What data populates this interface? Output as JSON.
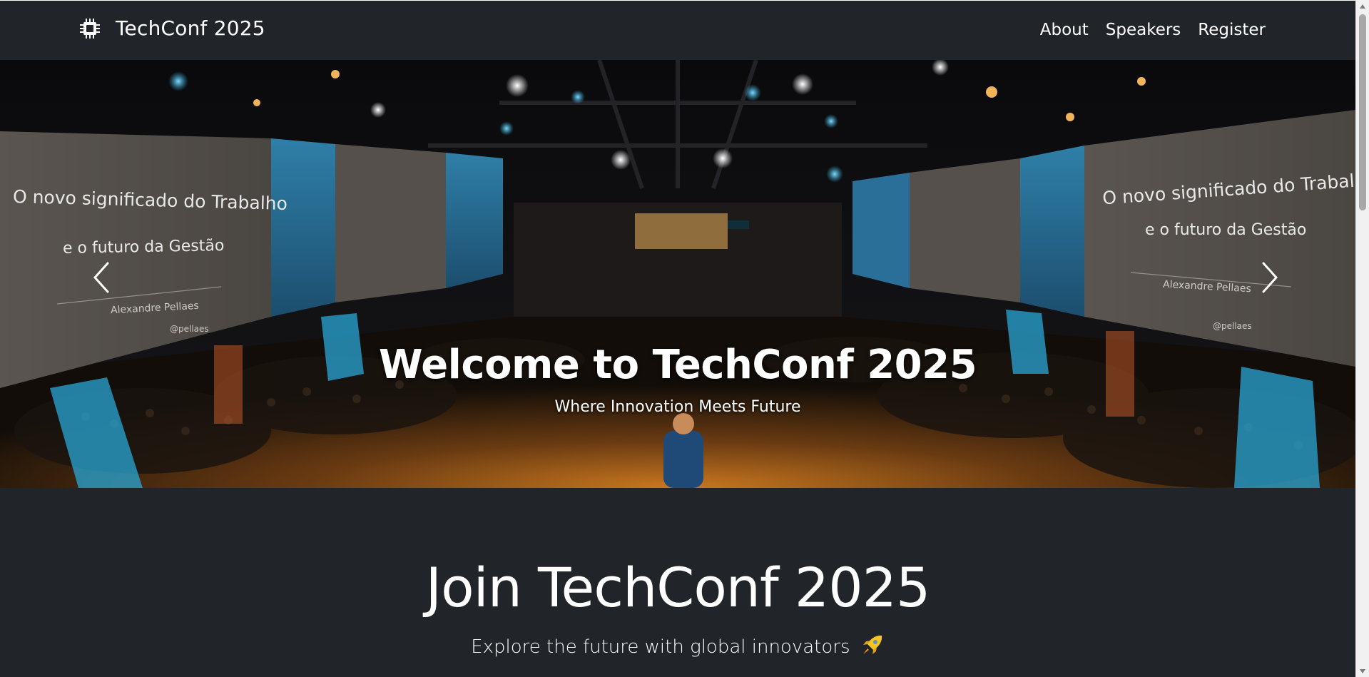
{
  "navbar": {
    "brand": "TechConf 2025",
    "brand_icon": "cpu-chip-icon",
    "links": [
      {
        "label": "About"
      },
      {
        "label": "Speakers"
      },
      {
        "label": "Register"
      }
    ]
  },
  "hero": {
    "title": "Welcome to TechConf 2025",
    "subtitle": "Where Innovation Meets Future",
    "prev_icon": "chevron-left-icon",
    "next_icon": "chevron-right-icon",
    "screen_left": {
      "line1": "O novo significado do Trabalho",
      "line2": "e o futuro da Gestão",
      "author": "Alexandre Pellaes",
      "handle": "@pellaes"
    },
    "screen_right": {
      "line1": "O novo significado do Trabalho",
      "line2": "e o futuro da Gestão",
      "author": "Alexandre Pellaes",
      "handle": "@pellaes"
    }
  },
  "join": {
    "title": "Join TechConf 2025",
    "subtitle": "Explore the future with global innovators",
    "icon": "rocket-icon"
  },
  "colors": {
    "background": "#212529",
    "text": "#ffffff",
    "stage_blue": "#2aa7d6",
    "stage_warm": "#f0a040"
  }
}
